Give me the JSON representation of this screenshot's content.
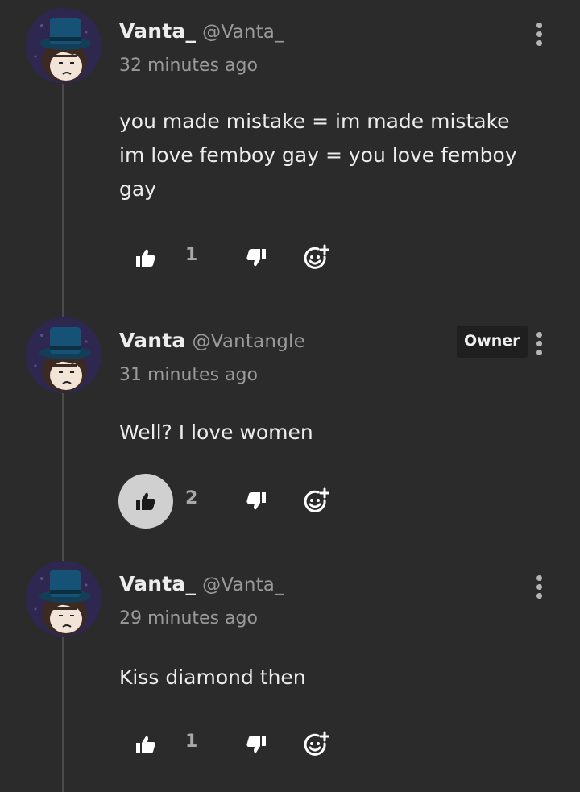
{
  "comments": [
    {
      "author": "Vanta_",
      "handle": "@Vanta_",
      "time": "32 minutes ago",
      "text": "you made mistake = im made mistake\nim love femboy gay = you love femboy\ngay",
      "likes": "1",
      "liked": false,
      "badge": ""
    },
    {
      "author": "Vanta",
      "handle": "@Vantangle",
      "time": "31 minutes ago",
      "text": "Well? I love women",
      "likes": "2",
      "liked": true,
      "badge": "Owner"
    },
    {
      "author": "Vanta_",
      "handle": "@Vanta_",
      "time": "29 minutes ago",
      "text": "Kiss diamond then",
      "likes": "1",
      "liked": false,
      "badge": ""
    }
  ],
  "icons": {
    "like": "thumbs-up-icon",
    "dislike": "thumbs-down-icon",
    "react": "add-reaction-icon",
    "menu": "more-vertical-icon"
  },
  "colors": {
    "background": "#2b2b2b",
    "text": "#ededed",
    "muted": "#9a9a9a",
    "liked_bg": "#d0d0d0"
  }
}
